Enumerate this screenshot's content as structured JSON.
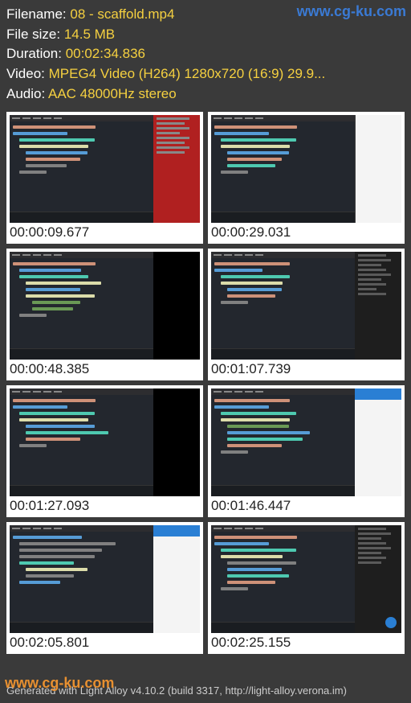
{
  "watermarks": {
    "top": "www.cg-ku.com",
    "bottom": "www.cg-ku.com"
  },
  "meta": {
    "filename_label": "Filename:",
    "filename_value": "08 - scaffold.mp4",
    "filesize_label": "File size:",
    "filesize_value": "14.5 MB",
    "duration_label": "Duration:",
    "duration_value": "00:02:34.836",
    "video_label": "Video:",
    "video_value": "MPEG4 Video (H264) 1280x720 (16:9) 29.9...",
    "audio_label": "Audio:",
    "audio_value": "AAC 48000Hz stereo"
  },
  "thumbs": [
    {
      "time": "00:00:09.677"
    },
    {
      "time": "00:00:29.031"
    },
    {
      "time": "00:00:48.385"
    },
    {
      "time": "00:01:07.739"
    },
    {
      "time": "00:01:27.093"
    },
    {
      "time": "00:01:46.447"
    },
    {
      "time": "00:02:05.801"
    },
    {
      "time": "00:02:25.155"
    }
  ],
  "footer": "Generated with Light Alloy v4.10.2 (build 3317, http://light-alloy.verona.im)"
}
